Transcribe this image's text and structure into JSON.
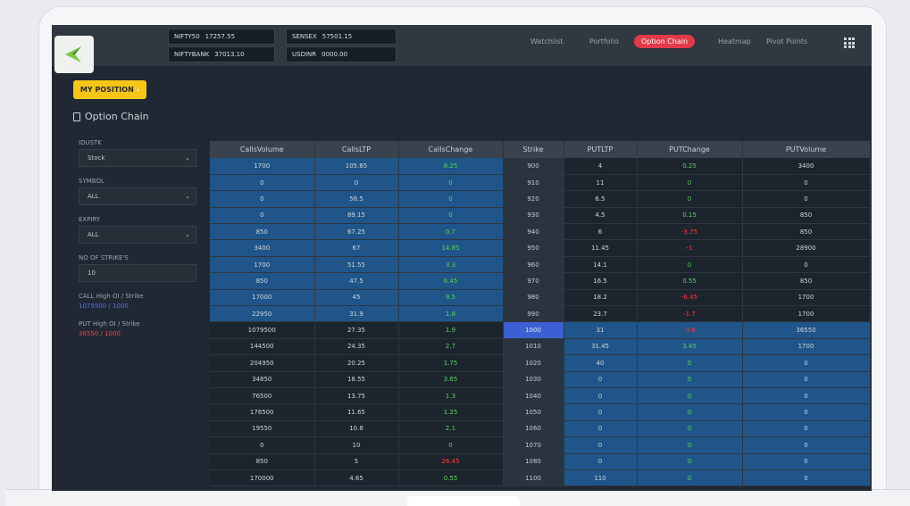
{
  "header": {
    "tickers": [
      {
        "name": "NIFTY50",
        "value": "17257.55"
      },
      {
        "name": "SENSEX",
        "value": "57501.15"
      },
      {
        "name": "NIFTYBANK",
        "value": "37013.10"
      },
      {
        "name": "USDINR",
        "value": "0000.00"
      }
    ],
    "nav": [
      "Watchlist",
      "Portfolio",
      "Option Chain",
      "Heatmap",
      "Pivot Points"
    ],
    "active_nav": "Option Chain"
  },
  "my_position_label": "MY POSITION",
  "page_title": "Option Chain",
  "filters": {
    "idustk_label": "IDUSTK",
    "idustk_value": "Stock",
    "symbol_label": "SYMBOL",
    "symbol_value": "ALL",
    "expiry_label": "EXPIRY",
    "expiry_value": "ALL",
    "strikes_label": "NO OF STRIKE'S",
    "strikes_value": "10",
    "call_high_label": "CALL High OI / Strike",
    "call_high_value": "1079500 / 1000",
    "put_high_label": "PUT High OI / Strike",
    "put_high_value": "36550 / 1000"
  },
  "colors": {
    "call_high": "#5a6cff",
    "put_high": "#ff3b3b",
    "itm": "#1f5588",
    "atm": "#3c5fd4",
    "accent": "#e33a4a"
  },
  "table": {
    "columns": [
      "CallsVolume",
      "CallsLTP",
      "CallsChange",
      "Strike",
      "PUTLTP",
      "PUTChange",
      "PUTVolume"
    ],
    "atm_strike": "1000",
    "rows": [
      [
        "1700",
        "105.65",
        "8.25",
        "900",
        "4",
        "0.25",
        "3400"
      ],
      [
        "0",
        "0",
        "0",
        "910",
        "11",
        "0",
        "0"
      ],
      [
        "0",
        "58.5",
        "0",
        "920",
        "6.5",
        "0",
        "0"
      ],
      [
        "0",
        "89.15",
        "0",
        "930",
        "4.5",
        "0.15",
        "850"
      ],
      [
        "850",
        "67.25",
        "0.7",
        "940",
        "6",
        "-3.75",
        "850"
      ],
      [
        "3400",
        "67",
        "14.85",
        "950",
        "11.45",
        "-1",
        "28900"
      ],
      [
        "1700",
        "51.55",
        "3.3",
        "960",
        "14.1",
        "0",
        "0"
      ],
      [
        "850",
        "47.5",
        "6.45",
        "970",
        "16.5",
        "0.55",
        "850"
      ],
      [
        "17000",
        "45",
        "9.5",
        "980",
        "18.2",
        "-6.45",
        "1700"
      ],
      [
        "22950",
        "31.9",
        "1.8",
        "990",
        "23.7",
        "-1.7",
        "1700"
      ],
      [
        "1079500",
        "27.35",
        "1.9",
        "1000",
        "31",
        "-3.6",
        "36550"
      ],
      [
        "144500",
        "24.35",
        "2.7",
        "1010",
        "31.45",
        "3.45",
        "1700"
      ],
      [
        "204950",
        "20.25",
        "1.75",
        "1020",
        "40",
        "0",
        "0"
      ],
      [
        "34850",
        "18.55",
        "3.65",
        "1030",
        "0",
        "0",
        "0"
      ],
      [
        "76500",
        "13.75",
        "1.3",
        "1040",
        "0",
        "0",
        "0"
      ],
      [
        "178500",
        "11.65",
        "1.25",
        "1050",
        "0",
        "0",
        "0"
      ],
      [
        "19550",
        "10.8",
        "2.1",
        "1060",
        "0",
        "0",
        "0"
      ],
      [
        "0",
        "10",
        "0",
        "1070",
        "0",
        "0",
        "0"
      ],
      [
        "850",
        "5",
        "26.45",
        "1080",
        "0",
        "0",
        "0"
      ],
      [
        "170000",
        "4.65",
        "0.55",
        "1100",
        "110",
        "0",
        "0"
      ]
    ],
    "neg_calls_change_rows": [
      18
    ]
  }
}
